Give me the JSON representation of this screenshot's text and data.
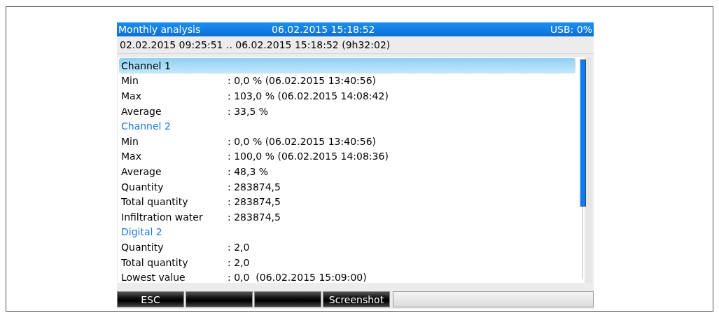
{
  "title_bar": {
    "title": "Monthly analysis",
    "datetime": "06.02.2015 15:18:52",
    "usb": "USB: 0%"
  },
  "period": "02.02.2015 09:25:51 .. 06.02.2015 15:18:52 (9h32:02)",
  "items": [
    {
      "kind": "header",
      "label": "Channel 1",
      "selected": true
    },
    {
      "kind": "row",
      "label": "Min",
      "value": ": 0,0 % (06.02.2015 13:40:56)"
    },
    {
      "kind": "row",
      "label": "Max",
      "value": ": 103,0 % (06.02.2015 14:08:42)"
    },
    {
      "kind": "row",
      "label": "Average",
      "value": ": 33,5 %"
    },
    {
      "kind": "header",
      "label": "Channel 2",
      "selected": false
    },
    {
      "kind": "row",
      "label": "Min",
      "value": ": 0,0 % (06.02.2015 13:40:56)"
    },
    {
      "kind": "row",
      "label": "Max",
      "value": ": 100,0 % (06.02.2015 14:08:36)"
    },
    {
      "kind": "row",
      "label": "Average",
      "value": ": 48,3 %"
    },
    {
      "kind": "row",
      "label": "Quantity",
      "value": ": 283874,5"
    },
    {
      "kind": "row",
      "label": "Total quantity",
      "value": ": 283874,5"
    },
    {
      "kind": "row",
      "label": "Infiltration water",
      "value": ": 283874,5"
    },
    {
      "kind": "header",
      "label": "Digital 2",
      "selected": false
    },
    {
      "kind": "row",
      "label": "Quantity",
      "value": ": 2,0"
    },
    {
      "kind": "row",
      "label": "Total quantity",
      "value": ": 2,0"
    },
    {
      "kind": "row",
      "label": "Lowest value",
      "value": ": 0,0  (06.02.2015 15:09:00)"
    }
  ],
  "softkeys": [
    {
      "kind": "key",
      "label": "ESC"
    },
    {
      "kind": "key"
    },
    {
      "kind": "key"
    },
    {
      "kind": "key",
      "label": "Screenshot"
    },
    {
      "kind": "panel"
    }
  ]
}
